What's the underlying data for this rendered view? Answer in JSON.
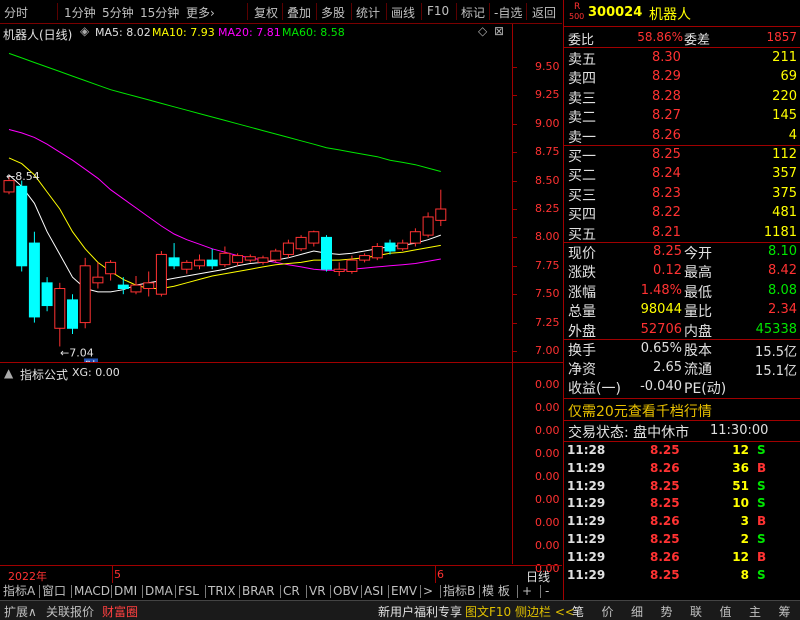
{
  "toolbar": {
    "items": [
      "分时",
      "1分钟",
      "5分钟",
      "15分钟",
      "更多›",
      "复权",
      "叠加",
      "多股",
      "统计",
      "画线",
      "F10",
      "标记",
      "-自选",
      "返回"
    ]
  },
  "chart": {
    "stock_label": "机器人(日线)",
    "ma5": "MA5: 8.02",
    "ma10": "MA10: 7.93",
    "ma20": "MA20: 7.81",
    "ma60": "MA60: 8.58",
    "high_mark": "8.54",
    "low_mark": "7.04",
    "cai_badge": "财",
    "colors": {
      "ma5": "#ffffff",
      "ma10": "#ffff00",
      "ma20": "#ff00ff",
      "ma60": "#00e600",
      "up": "#ff3232",
      "down": "#00ffff",
      "axis": "#a00000"
    }
  },
  "chart_data": {
    "type": "candlestick",
    "y_ticks": [
      "9.50",
      "9.25",
      "9.00",
      "8.75",
      "8.50",
      "8.25",
      "8.00",
      "7.75",
      "7.50",
      "7.25",
      "7.00"
    ],
    "ylim": [
      7.0,
      9.5
    ],
    "x_ticks": [
      "2022年",
      "5",
      "6"
    ],
    "candles": [
      {
        "o": 8.4,
        "c": 8.5,
        "h": 8.54,
        "l": 8.38
      },
      {
        "o": 8.45,
        "c": 7.75,
        "h": 8.5,
        "l": 7.7
      },
      {
        "o": 7.95,
        "c": 7.3,
        "h": 8.05,
        "l": 7.25
      },
      {
        "o": 7.6,
        "c": 7.4,
        "h": 7.65,
        "l": 7.35
      },
      {
        "o": 7.2,
        "c": 7.55,
        "h": 7.6,
        "l": 7.04
      },
      {
        "o": 7.45,
        "c": 7.2,
        "h": 7.5,
        "l": 7.15
      },
      {
        "o": 7.25,
        "c": 7.75,
        "h": 7.82,
        "l": 7.2
      },
      {
        "o": 7.6,
        "c": 7.65,
        "h": 7.78,
        "l": 7.55
      },
      {
        "o": 7.68,
        "c": 7.78,
        "h": 7.8,
        "l": 7.62
      },
      {
        "o": 7.58,
        "c": 7.55,
        "h": 7.65,
        "l": 7.5
      },
      {
        "o": 7.52,
        "c": 7.58,
        "h": 7.66,
        "l": 7.5
      },
      {
        "o": 7.55,
        "c": 7.6,
        "h": 7.7,
        "l": 7.48
      },
      {
        "o": 7.5,
        "c": 7.85,
        "h": 7.88,
        "l": 7.48
      },
      {
        "o": 7.82,
        "c": 7.75,
        "h": 7.95,
        "l": 7.72
      },
      {
        "o": 7.72,
        "c": 7.78,
        "h": 7.8,
        "l": 7.68
      },
      {
        "o": 7.75,
        "c": 7.8,
        "h": 7.85,
        "l": 7.72
      },
      {
        "o": 7.8,
        "c": 7.75,
        "h": 7.9,
        "l": 7.72
      },
      {
        "o": 7.76,
        "c": 7.86,
        "h": 7.92,
        "l": 7.74
      },
      {
        "o": 7.78,
        "c": 7.84,
        "h": 7.86,
        "l": 7.75
      },
      {
        "o": 7.8,
        "c": 7.83,
        "h": 7.85,
        "l": 7.78
      },
      {
        "o": 7.78,
        "c": 7.82,
        "h": 7.84,
        "l": 7.76
      },
      {
        "o": 7.8,
        "c": 7.88,
        "h": 7.9,
        "l": 7.78
      },
      {
        "o": 7.85,
        "c": 7.95,
        "h": 7.98,
        "l": 7.82
      },
      {
        "o": 7.9,
        "c": 8.0,
        "h": 8.02,
        "l": 7.88
      },
      {
        "o": 7.95,
        "c": 8.05,
        "h": 8.06,
        "l": 7.92
      },
      {
        "o": 8.0,
        "c": 7.72,
        "h": 8.02,
        "l": 7.7
      },
      {
        "o": 7.7,
        "c": 7.72,
        "h": 7.78,
        "l": 7.66
      },
      {
        "o": 7.7,
        "c": 7.8,
        "h": 7.84,
        "l": 7.68
      },
      {
        "o": 7.8,
        "c": 7.84,
        "h": 7.86,
        "l": 7.78
      },
      {
        "o": 7.82,
        "c": 7.92,
        "h": 7.95,
        "l": 7.8
      },
      {
        "o": 7.95,
        "c": 7.88,
        "h": 7.98,
        "l": 7.85
      },
      {
        "o": 7.9,
        "c": 7.95,
        "h": 7.98,
        "l": 7.88
      },
      {
        "o": 7.95,
        "c": 8.05,
        "h": 8.08,
        "l": 7.92
      },
      {
        "o": 8.02,
        "c": 8.18,
        "h": 8.22,
        "l": 8.0
      },
      {
        "o": 8.15,
        "c": 8.25,
        "h": 8.42,
        "l": 8.1
      }
    ],
    "ma5": [
      8.55,
      8.45,
      8.3,
      8.05,
      7.85,
      7.65,
      7.55,
      7.52,
      7.52,
      7.54,
      7.58,
      7.6,
      7.62,
      7.64,
      7.66,
      7.68,
      7.7,
      7.72,
      7.75,
      7.77,
      7.78,
      7.8,
      7.82,
      7.85,
      7.88,
      7.86,
      7.85,
      7.86,
      7.88,
      7.9,
      7.92,
      7.93,
      7.95,
      7.98,
      8.02
    ],
    "ma10": [
      8.7,
      8.65,
      8.55,
      8.4,
      8.25,
      8.05,
      7.9,
      7.78,
      7.7,
      7.63,
      7.58,
      7.55,
      7.55,
      7.57,
      7.6,
      7.63,
      7.66,
      7.68,
      7.7,
      7.72,
      7.74,
      7.76,
      7.77,
      7.78,
      7.8,
      7.8,
      7.8,
      7.81,
      7.82,
      7.84,
      7.86,
      7.87,
      7.89,
      7.91,
      7.93
    ],
    "ma20": [
      8.95,
      8.92,
      8.88,
      8.82,
      8.75,
      8.68,
      8.6,
      8.52,
      8.42,
      8.34,
      8.26,
      8.18,
      8.1,
      8.03,
      7.98,
      7.94,
      7.9,
      7.87,
      7.84,
      7.82,
      7.8,
      7.78,
      7.76,
      7.74,
      7.72,
      7.71,
      7.71,
      7.72,
      7.73,
      7.74,
      7.75,
      7.76,
      7.77,
      7.79,
      7.81
    ],
    "ma60": [
      9.62,
      9.58,
      9.54,
      9.5,
      9.46,
      9.42,
      9.38,
      9.34,
      9.3,
      9.27,
      9.24,
      9.21,
      9.18,
      9.15,
      9.12,
      9.09,
      9.06,
      9.03,
      9.0,
      8.97,
      8.94,
      8.91,
      8.88,
      8.85,
      8.82,
      8.79,
      8.77,
      8.75,
      8.73,
      8.71,
      8.68,
      8.66,
      8.64,
      8.61,
      8.58
    ]
  },
  "indicator": {
    "label": "指标公式",
    "value": "XG: 0.00",
    "y_ticks": [
      "0.00",
      "0.00",
      "0.00",
      "0.00",
      "0.00",
      "0.00",
      "0.00",
      "0.00",
      "0.00"
    ]
  },
  "time_axis": {
    "right_label": "日线"
  },
  "indicator_tabs": [
    "指标A",
    "窗口",
    "MACD",
    "DMI",
    "DMA",
    "FSL",
    "TRIX",
    "BRAR",
    "CR",
    "VR",
    "OBV",
    "ASI",
    "EMV",
    ">",
    "指标B",
    "模 板",
    "+",
    "-"
  ],
  "footer": {
    "left": [
      "扩展∧",
      "关联报价",
      "财富圈"
    ],
    "center": [
      "新用户福利专享",
      "图文F10",
      "侧边栏 <<"
    ],
    "right": [
      "笔",
      "价",
      "细",
      "势",
      "联",
      "值",
      "主",
      "筹"
    ]
  },
  "quote": {
    "badge_top": "R",
    "badge_bottom": "500",
    "code": "300024",
    "name": "机器人",
    "weibi_label": "委比",
    "weibi": "58.86%",
    "weicha_label": "委差",
    "weicha": "1857",
    "sells": [
      {
        "label": "卖五",
        "price": "8.30",
        "vol": "211"
      },
      {
        "label": "卖四",
        "price": "8.29",
        "vol": "69"
      },
      {
        "label": "卖三",
        "price": "8.28",
        "vol": "220"
      },
      {
        "label": "卖二",
        "price": "8.27",
        "vol": "145"
      },
      {
        "label": "卖一",
        "price": "8.26",
        "vol": "4"
      }
    ],
    "buys": [
      {
        "label": "买一",
        "price": "8.25",
        "vol": "112"
      },
      {
        "label": "买二",
        "price": "8.24",
        "vol": "357"
      },
      {
        "label": "买三",
        "price": "8.23",
        "vol": "375"
      },
      {
        "label": "买四",
        "price": "8.22",
        "vol": "481"
      },
      {
        "label": "买五",
        "price": "8.21",
        "vol": "1181"
      }
    ],
    "stats": [
      {
        "l1": "现价",
        "v1": "8.25",
        "c1": "red",
        "l2": "今开",
        "v2": "8.10",
        "c2": "green"
      },
      {
        "l1": "涨跌",
        "v1": "0.12",
        "c1": "red",
        "l2": "最高",
        "v2": "8.42",
        "c2": "red"
      },
      {
        "l1": "涨幅",
        "v1": "1.48%",
        "c1": "red",
        "l2": "最低",
        "v2": "8.08",
        "c2": "green"
      },
      {
        "l1": "总量",
        "v1": "98044",
        "c1": "yellow",
        "l2": "量比",
        "v2": "2.34",
        "c2": "red"
      },
      {
        "l1": "外盘",
        "v1": "52706",
        "c1": "red",
        "l2": "内盘",
        "v2": "45338",
        "c2": "green"
      }
    ],
    "stats2": [
      {
        "l1": "换手",
        "v1": "0.65%",
        "l2": "股本",
        "v2": "15.5亿"
      },
      {
        "l1": "净资",
        "v1": "2.65",
        "l2": "流通",
        "v2": "15.1亿"
      },
      {
        "l1": "收益(一)",
        "v1": "-0.040",
        "l2": "PE(动)",
        "v2": ""
      }
    ],
    "promo": "仅需20元查看千档行情",
    "trade_status": "交易状态: 盘中休市",
    "trade_time": "11:30:00",
    "ticks": [
      {
        "time": "11:28",
        "price": "8.25",
        "vol": "12",
        "side": "S"
      },
      {
        "time": "11:29",
        "price": "8.26",
        "vol": "36",
        "side": "B"
      },
      {
        "time": "11:29",
        "price": "8.25",
        "vol": "51",
        "side": "S"
      },
      {
        "time": "11:29",
        "price": "8.25",
        "vol": "10",
        "side": "S"
      },
      {
        "time": "11:29",
        "price": "8.26",
        "vol": "3",
        "side": "B"
      },
      {
        "time": "11:29",
        "price": "8.25",
        "vol": "2",
        "side": "S"
      },
      {
        "time": "11:29",
        "price": "8.26",
        "vol": "12",
        "side": "B"
      },
      {
        "time": "11:29",
        "price": "8.25",
        "vol": "8",
        "side": "S"
      }
    ]
  }
}
